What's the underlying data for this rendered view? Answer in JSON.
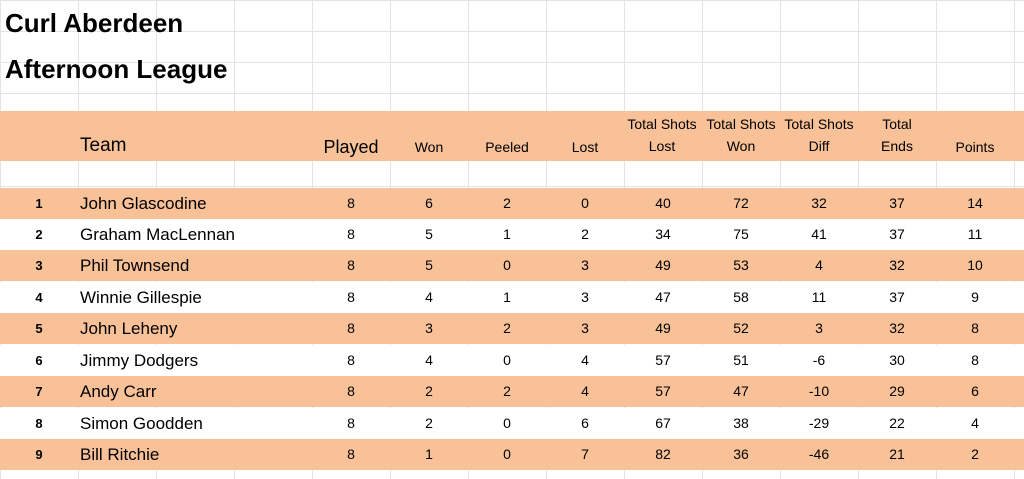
{
  "title": "Curl Aberdeen",
  "subtitle": "Afternoon League",
  "headers": {
    "team": "Team",
    "played": "Played",
    "won": "Won",
    "peeled": "Peeled",
    "lost": "Lost",
    "tsl_1": "Total Shots",
    "tsl_2": "Lost",
    "tsw_1": "Total Shots",
    "tsw_2": "Won",
    "tsd_1": "Total Shots",
    "tsd_2": "Diff",
    "ends_1": "Total",
    "ends_2": "Ends",
    "points": "Points"
  },
  "colors": {
    "band": "#f8c197",
    "grid": "#e3e3e3"
  },
  "rows": [
    {
      "rank": "1",
      "team": "John Glascodine",
      "played": "8",
      "won": "6",
      "peeled": "2",
      "lost": "0",
      "shots_lost": "40",
      "shots_won": "72",
      "diff": "32",
      "ends": "37",
      "points": "14"
    },
    {
      "rank": "2",
      "team": "Graham MacLennan",
      "played": "8",
      "won": "5",
      "peeled": "1",
      "lost": "2",
      "shots_lost": "34",
      "shots_won": "75",
      "diff": "41",
      "ends": "37",
      "points": "11"
    },
    {
      "rank": "3",
      "team": "Phil Townsend",
      "played": "8",
      "won": "5",
      "peeled": "0",
      "lost": "3",
      "shots_lost": "49",
      "shots_won": "53",
      "diff": "4",
      "ends": "32",
      "points": "10"
    },
    {
      "rank": "4",
      "team": "Winnie Gillespie",
      "played": "8",
      "won": "4",
      "peeled": "1",
      "lost": "3",
      "shots_lost": "47",
      "shots_won": "58",
      "diff": "11",
      "ends": "37",
      "points": "9"
    },
    {
      "rank": "5",
      "team": "John Leheny",
      "played": "8",
      "won": "3",
      "peeled": "2",
      "lost": "3",
      "shots_lost": "49",
      "shots_won": "52",
      "diff": "3",
      "ends": "32",
      "points": "8"
    },
    {
      "rank": "6",
      "team": "Jimmy Dodgers",
      "played": "8",
      "won": "4",
      "peeled": "0",
      "lost": "4",
      "shots_lost": "57",
      "shots_won": "51",
      "diff": "-6",
      "ends": "30",
      "points": "8"
    },
    {
      "rank": "7",
      "team": "Andy Carr",
      "played": "8",
      "won": "2",
      "peeled": "2",
      "lost": "4",
      "shots_lost": "57",
      "shots_won": "47",
      "diff": "-10",
      "ends": "29",
      "points": "6"
    },
    {
      "rank": "8",
      "team": "Simon Goodden",
      "played": "8",
      "won": "2",
      "peeled": "0",
      "lost": "6",
      "shots_lost": "67",
      "shots_won": "38",
      "diff": "-29",
      "ends": "22",
      "points": "4"
    },
    {
      "rank": "9",
      "team": "Bill Ritchie",
      "played": "8",
      "won": "1",
      "peeled": "0",
      "lost": "7",
      "shots_lost": "82",
      "shots_won": "36",
      "diff": "-46",
      "ends": "21",
      "points": "2"
    }
  ]
}
